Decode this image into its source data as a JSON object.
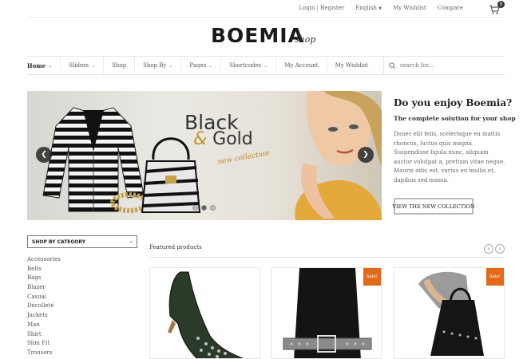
{
  "topbar": {
    "login": "Login | Register",
    "language": "English",
    "wishlist": "My Wishlist",
    "compare": "Compare",
    "cart_count": "0"
  },
  "logo": {
    "main": "BOEMIA",
    "shop": "shop"
  },
  "nav": {
    "items": [
      {
        "label": "Home",
        "has_dropdown": true
      },
      {
        "label": "Sliders",
        "has_dropdown": true
      },
      {
        "label": "Shop",
        "has_dropdown": false
      },
      {
        "label": "Shop By",
        "has_dropdown": true
      },
      {
        "label": "Pages",
        "has_dropdown": true
      },
      {
        "label": "Shortcodes",
        "has_dropdown": true
      },
      {
        "label": "My Account",
        "has_dropdown": false
      },
      {
        "label": "My Wishlist",
        "has_dropdown": false
      }
    ],
    "search_placeholder": "search for..."
  },
  "slider": {
    "line1": "Black",
    "amp": "&",
    "line2": "Gold",
    "line3": "new collection",
    "dots": 3,
    "active_dot": 1
  },
  "promo": {
    "title": "Do you enjoy Boemia?",
    "subtitle": "The complete solution for your shop",
    "body": "Donec elit felis, scelerisque eu mattis rhoncus, luctus quis magna. Suspendisse ligula nunc, aliquam auctor volutpat a, pretium vitae neque. Mauris odio est, varius eu mollis et, dapibus sed massa.",
    "button": "VIEW THE NEW COLLECTION"
  },
  "categories": {
    "heading": "SHOP BY CATEGORY",
    "toggle": "–",
    "items": [
      "Accessories",
      "Belts",
      "Bags",
      "Blazer",
      "Casual",
      "Décolleté",
      "Jackets",
      "Man",
      "Shirt",
      "Slim Fit",
      "Trousers"
    ]
  },
  "featured": {
    "title": "Featured products",
    "sale_label": "Sale!"
  },
  "colors": {
    "accent": "#e06a1a",
    "text": "#333333",
    "border": "#e4e4e4"
  }
}
